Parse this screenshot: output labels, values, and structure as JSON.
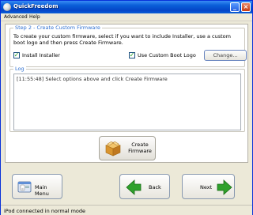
{
  "window": {
    "title": "QuickFreedom"
  },
  "menu": {
    "items": [
      "Advanced",
      "Help"
    ]
  },
  "step": {
    "legend": "Step 2 - Create Custom Firmware",
    "description": "To create your custom firmware, select if you want to include Installer, use a custom boot logo and then press Create Firmware.",
    "installer_label": "Install Installer",
    "bootlogo_label": "Use Custom Boot Logo",
    "change_button": "Change...",
    "installer_checked": true,
    "bootlogo_checked": true
  },
  "log": {
    "legend": "Log",
    "lines": [
      "[11:55:48] Select options above and click Create Firmware"
    ]
  },
  "create": {
    "label_line1": "Create",
    "label_line2": "Firmware"
  },
  "nav": {
    "main_menu": "Main Menu",
    "back": "Back",
    "next": "Next"
  },
  "status": {
    "text": "iPod connected in normal mode"
  },
  "colors": {
    "titlebar": "#0a5fd8",
    "legend": "#2e6fd0",
    "arrow_green": "#2fa12c"
  },
  "icons": {
    "create": "box-icon",
    "main_menu": "ipod-window-icon",
    "back": "arrow-left-icon",
    "next": "arrow-right-icon"
  }
}
